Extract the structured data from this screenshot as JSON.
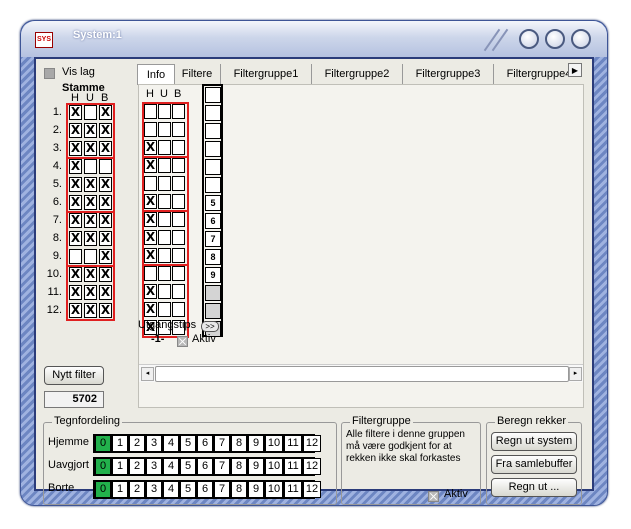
{
  "window": {
    "title": "System:1",
    "app_icon_text": "SYS"
  },
  "left": {
    "vis_lag_label": "Vis lag",
    "stamme_title": "Stamme",
    "col_headers": [
      "H",
      "U",
      "B"
    ],
    "rows": [
      {
        "n": "1.",
        "h": "X",
        "u": "",
        "b": "X"
      },
      {
        "n": "2.",
        "h": "X",
        "u": "X",
        "b": "X"
      },
      {
        "n": "3.",
        "h": "X",
        "u": "X",
        "b": "X"
      },
      {
        "n": "4.",
        "h": "X",
        "u": "",
        "b": ""
      },
      {
        "n": "5.",
        "h": "X",
        "u": "X",
        "b": "X"
      },
      {
        "n": "6.",
        "h": "X",
        "u": "X",
        "b": "X"
      },
      {
        "n": "7.",
        "h": "X",
        "u": "X",
        "b": "X"
      },
      {
        "n": "8.",
        "h": "X",
        "u": "X",
        "b": "X"
      },
      {
        "n": "9.",
        "h": "",
        "u": "",
        "b": "X"
      },
      {
        "n": "10.",
        "h": "X",
        "u": "X",
        "b": "X"
      },
      {
        "n": "11.",
        "h": "X",
        "u": "X",
        "b": "X"
      },
      {
        "n": "12.",
        "h": "X",
        "u": "X",
        "b": "X"
      }
    ],
    "nytt_filter": "Nytt filter",
    "count": "5702"
  },
  "tabs": [
    "Info",
    "Filtere",
    "Filtergruppe1",
    "Filtergruppe2",
    "Filtergruppe3",
    "Filtergruppe4"
  ],
  "tab_scroll": "▶",
  "filter": {
    "col_headers": [
      "H",
      "U",
      "B"
    ],
    "rows": [
      {
        "h": "",
        "u": "",
        "b": "",
        "num": ""
      },
      {
        "h": "",
        "u": "",
        "b": "",
        "num": ""
      },
      {
        "h": "X",
        "u": "",
        "b": "",
        "num": ""
      },
      {
        "h": "X",
        "u": "",
        "b": "",
        "num": ""
      },
      {
        "h": "",
        "u": "",
        "b": "",
        "num": ""
      },
      {
        "h": "X",
        "u": "",
        "b": "",
        "num": "5"
      },
      {
        "h": "X",
        "u": "",
        "b": "",
        "num": "6"
      },
      {
        "h": "X",
        "u": "",
        "b": "",
        "num": "7"
      },
      {
        "h": "X",
        "u": "",
        "b": "",
        "num": "8"
      },
      {
        "h": "",
        "u": "",
        "b": "",
        "num": "9"
      },
      {
        "h": "X",
        "u": "",
        "b": "",
        "num": ""
      },
      {
        "h": "X",
        "u": "",
        "b": "",
        "num": ""
      },
      {
        "h": "X",
        "u": "",
        "b": "",
        "num": ""
      }
    ],
    "utgangstips": "Utgangstips",
    "expand_btn": ">>",
    "index_label": "-1-",
    "aktiv": "Aktiv"
  },
  "tegnfordeling": {
    "title": "Tegnfordeling",
    "rows": [
      {
        "label": "Hjemme"
      },
      {
        "label": "Uavgjort"
      },
      {
        "label": "Borte"
      }
    ],
    "cells": [
      "0",
      "1",
      "2",
      "3",
      "4",
      "5",
      "6",
      "7",
      "8",
      "9",
      "10",
      "11",
      "12"
    ]
  },
  "filtergruppe": {
    "title": "Filtergruppe",
    "text": "Alle filtere i denne gruppen må være godkjent for at rekken ikke skal forkastes",
    "aktiv": "Aktiv"
  },
  "beregn": {
    "title": "Beregn rekker",
    "btn1": "Regn ut system",
    "btn2": "Fra samlebuffer",
    "btn3": "Regn ut ..."
  },
  "colors": {
    "frame": "#6d86c2",
    "red_border": "#e02020",
    "green": "#22b14c"
  }
}
